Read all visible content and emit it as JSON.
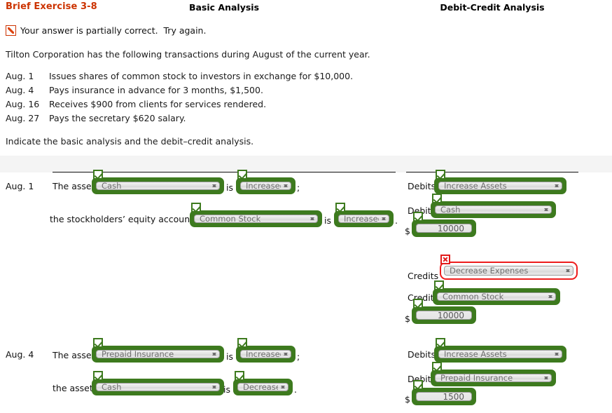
{
  "header": {
    "exercise_title": "Brief Exercise 3-8",
    "status_text": "Your answer is partially correct.  Try again.",
    "status_icon": "partial-correct-icon",
    "intro": "Tilton Corporation has the following transactions during August of the current year.",
    "instruction": "Indicate the basic analysis and the debit–credit analysis."
  },
  "transactions": [
    {
      "date": "Aug. 1",
      "description": "Issues shares of common stock to investors in exchange for $10,000."
    },
    {
      "date": "Aug. 4",
      "description": "Pays insurance in advance for 3 months, $1,500."
    },
    {
      "date": "Aug. 16",
      "description": "Receives $900 from clients for services rendered."
    },
    {
      "date": "Aug. 27",
      "description": "Pays the secretary $620 salary."
    }
  ],
  "table": {
    "headers": {
      "basic": "Basic Analysis",
      "debit_credit": "Debit-Credit Analysis"
    }
  },
  "aug1": {
    "date": "Aug. 1",
    "basic": {
      "line1_lead": "The asset",
      "line1_account": "Cash",
      "line1_is": "is",
      "line1_direction": "Increased",
      "line1_tail": ";",
      "line2_lead": "the stockholders’ equity account",
      "line2_account": "Common Stock",
      "line2_is": "is",
      "line2_direction": "Increased",
      "line2_tail": "."
    },
    "dc": {
      "debits_label": "Debits",
      "debits_value": "Increase Assets",
      "debit_label": "Debit",
      "debit_value": "Cash",
      "debit_currency": "$",
      "debit_amount": "10000",
      "credits_label": "Credits",
      "credits_value": "Decrease Expenses",
      "credit_label": "Credit",
      "credit_value": "Common Stock",
      "credit_currency": "$",
      "credit_amount": "10000"
    }
  },
  "aug4": {
    "date": "Aug. 4",
    "basic": {
      "line1_lead": "The asset",
      "line1_account": "Prepaid Insurance",
      "line1_is": "is",
      "line1_direction": "Increased",
      "line1_tail": ";",
      "line2_lead": "the asset",
      "line2_account": "Cash",
      "line2_is": "is",
      "line2_direction": "Decreased",
      "line2_tail": "."
    },
    "dc": {
      "debits_label": "Debits",
      "debits_value": "Increase Assets",
      "debit_label": "Debit",
      "debit_value": "Prepaid Insurance",
      "debit_currency": "$",
      "debit_amount": "1500"
    }
  },
  "colors": {
    "title": "#cc3300",
    "valid_border": "#3d7a1e",
    "error_border": "#ee1c1c",
    "header_band": "#f4f4f4"
  }
}
